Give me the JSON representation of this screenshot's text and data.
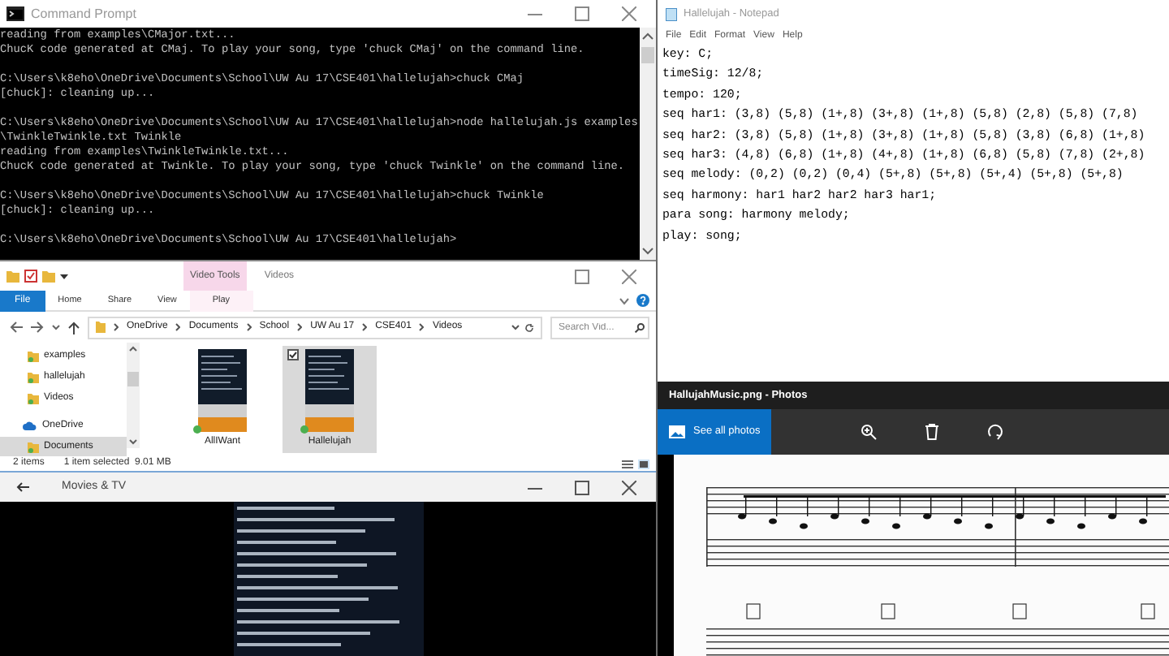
{
  "command_prompt": {
    "title": "Command Prompt",
    "blocks": [
      [
        "reading from examples\\CMajor.txt...",
        "ChucK code generated at CMaj. To play your song, type 'chuck CMaj' on the command line."
      ],
      [
        "C:\\Users\\k8eho\\OneDrive\\Documents\\School\\UW Au 17\\CSE401\\hallelujah>chuck CMaj",
        "[chuck]: cleaning up..."
      ],
      [
        "C:\\Users\\k8eho\\OneDrive\\Documents\\School\\UW Au 17\\CSE401\\hallelujah>node hallelujah.js examples",
        "\\TwinkleTwinkle.txt Twinkle",
        "reading from examples\\TwinkleTwinkle.txt...",
        "ChucK code generated at Twinkle. To play your song, type 'chuck Twinkle' on the command line."
      ],
      [
        "C:\\Users\\k8eho\\OneDrive\\Documents\\School\\UW Au 17\\CSE401\\hallelujah>chuck Twinkle",
        "[chuck]: cleaning up..."
      ],
      [
        "C:\\Users\\k8eho\\OneDrive\\Documents\\School\\UW Au 17\\CSE401\\hallelujah>"
      ]
    ]
  },
  "notepad": {
    "title": "Hallelujah - Notepad",
    "menu": [
      "File",
      "Edit",
      "Format",
      "View",
      "Help"
    ],
    "lines": [
      "key: C;",
      "timeSig: 12/8;",
      "tempo: 120;",
      "seq har1: (3,8) (5,8) (1+,8) (3+,8) (1+,8) (5,8) (2,8) (5,8) (7,8)",
      "seq har2: (3,8) (5,8) (1+,8) (3+,8) (1+,8) (5,8) (3,8) (6,8) (1+,8)",
      "seq har3: (4,8) (6,8) (1+,8) (4+,8) (1+,8) (6,8) (5,8) (7,8) (2+,8)",
      "seq melody: (0,2) (0,2) (0,4) (5+,8) (5+,8) (5+,4) (5+,8) (5+,8)",
      "seq harmony: har1 har2 har2 har3 har1;",
      "para song: harmony melody;",
      "play: song;"
    ]
  },
  "explorer": {
    "context_tab": "Video Tools",
    "title": "Videos",
    "ribbon_tabs": [
      {
        "label": "File",
        "kind": "file"
      },
      {
        "label": "Home",
        "kind": "tab"
      },
      {
        "label": "Share",
        "kind": "tab"
      },
      {
        "label": "View",
        "kind": "tab"
      },
      {
        "label": "Play",
        "kind": "context"
      }
    ],
    "path": [
      "OneDrive",
      "Documents",
      "School",
      "UW Au 17",
      "CSE401",
      "Videos"
    ],
    "search": {
      "placeholder": "Search Vid..."
    },
    "nav": [
      {
        "label": "examples",
        "kind": "folder",
        "selected": false
      },
      {
        "label": "hallelujah",
        "kind": "folder",
        "selected": false
      },
      {
        "label": "Videos",
        "kind": "folder",
        "selected": false
      },
      {
        "label": "OneDrive",
        "kind": "cloud",
        "selected": false
      },
      {
        "label": "Documents",
        "kind": "folder",
        "selected": true
      }
    ],
    "files": [
      {
        "name": "AllIWant",
        "selected": false
      },
      {
        "name": "Hallelujah",
        "selected": true
      }
    ],
    "status": [
      "2 items",
      "1 item selected  9.01 MB"
    ]
  },
  "photos": {
    "title": "HallujahMusic.png - Photos",
    "button": "See all photos"
  },
  "movies": {
    "title": "Movies & TV"
  }
}
